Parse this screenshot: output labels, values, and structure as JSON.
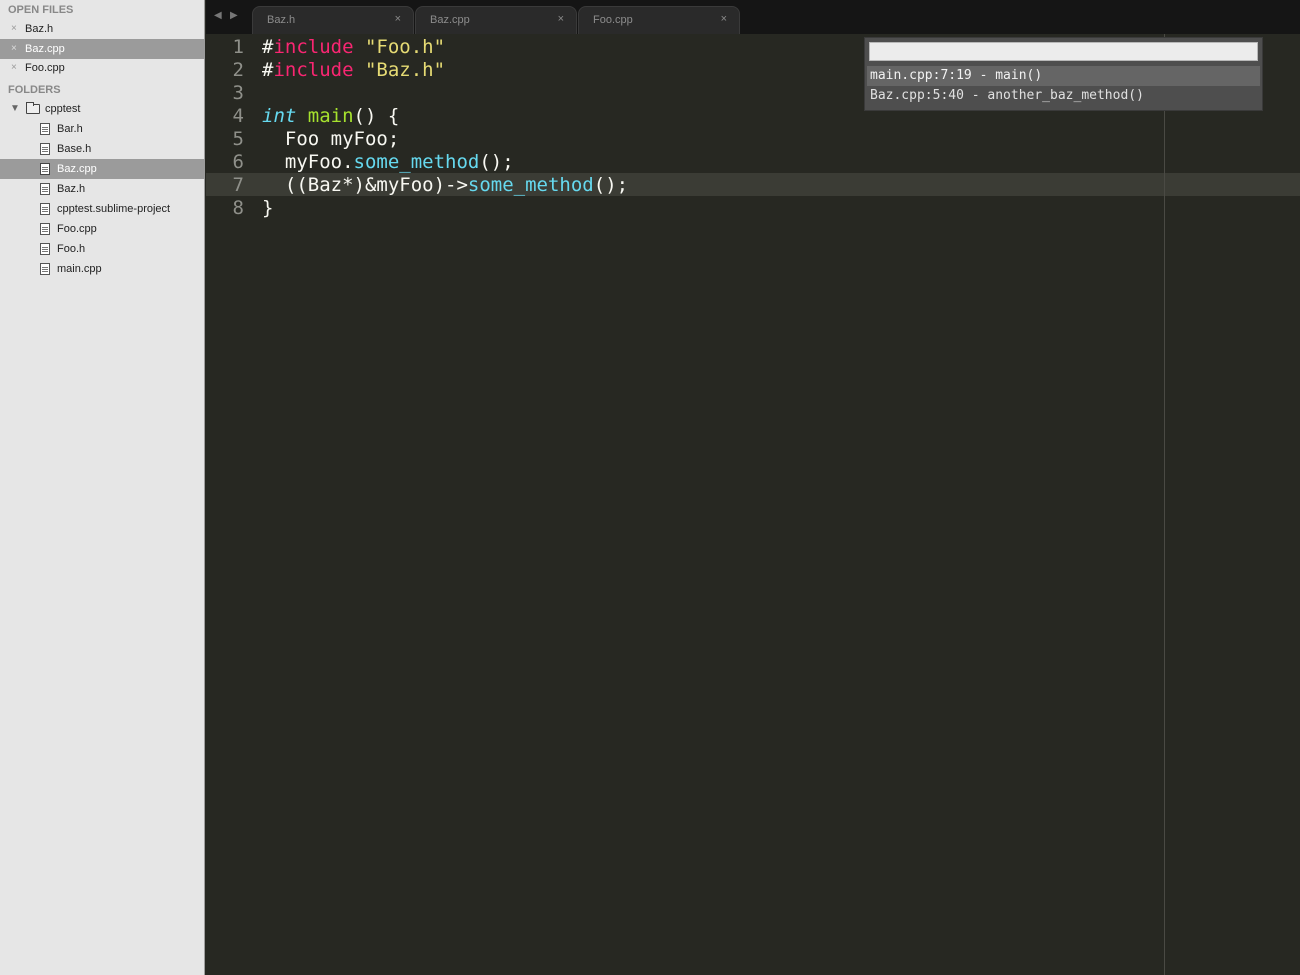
{
  "sidebar": {
    "open_files_header": "OPEN FILES",
    "open_files": [
      {
        "label": "Baz.h"
      },
      {
        "label": "Baz.cpp"
      },
      {
        "label": "Foo.cpp"
      }
    ],
    "close_glyph": "×",
    "folders_header": "FOLDERS",
    "folder": {
      "label": "cpptest",
      "arrow": "▼"
    },
    "tree_files": [
      {
        "label": "Bar.h"
      },
      {
        "label": "Base.h"
      },
      {
        "label": "Baz.cpp"
      },
      {
        "label": "Baz.h"
      },
      {
        "label": "cpptest.sublime-project"
      },
      {
        "label": "Foo.cpp"
      },
      {
        "label": "Foo.h"
      },
      {
        "label": "main.cpp"
      }
    ]
  },
  "tabbar": {
    "back_glyph": "◀",
    "forward_glyph": "▶",
    "tabs": [
      {
        "label": "Baz.h",
        "close": "×"
      },
      {
        "label": "Baz.cpp",
        "close": "×"
      },
      {
        "label": "Foo.cpp",
        "close": "×"
      }
    ]
  },
  "editor": {
    "line_numbers": [
      "1",
      "2",
      "3",
      "4",
      "5",
      "6",
      "7",
      "8"
    ],
    "lines": {
      "l1": {
        "a": "#",
        "b": "include",
        "c": " ",
        "d": "\"Foo.h\""
      },
      "l2": {
        "a": "#",
        "b": "include",
        "c": " ",
        "d": "\"Baz.h\""
      },
      "l4": {
        "a": "int",
        "b": " ",
        "c": "main",
        "d": "() {"
      },
      "l5": {
        "a": "  Foo myFoo;"
      },
      "l6": {
        "a": "  myFoo.",
        "b": "some_method",
        "c": "();"
      },
      "l7": {
        "a": "  ((Baz*)&myFoo)->",
        "b": "some_method",
        "c": "();"
      },
      "l8": {
        "a": "}"
      }
    }
  },
  "goto_popup": {
    "input_value": "",
    "results": [
      {
        "label": "main.cpp:7:19 - main()"
      },
      {
        "label": "Baz.cpp:5:40 - another_baz_method()"
      }
    ]
  },
  "colors": {
    "editor_bg": "#272822",
    "keyword": "#f92672",
    "string": "#e6db74",
    "type": "#66d9ef",
    "function": "#a6e22e",
    "sidebar_bg": "#e6e6e6"
  }
}
